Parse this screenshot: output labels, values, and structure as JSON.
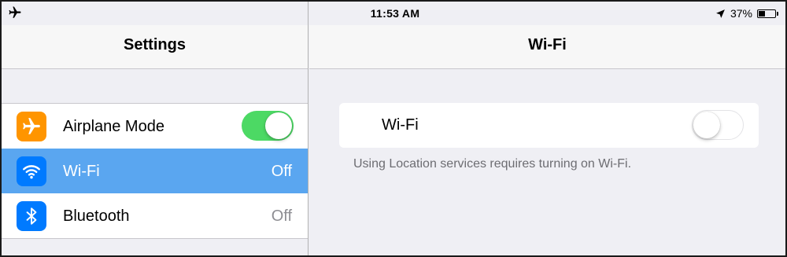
{
  "status_bar": {
    "left_icon": "airplane-icon",
    "time": "11:53 AM",
    "location_icon": "location-arrow-icon",
    "battery_percent": "37%",
    "battery_level": 0.37
  },
  "master": {
    "title": "Settings",
    "items": [
      {
        "label": "Airplane Mode",
        "icon": "airplane-icon",
        "icon_color": "#ff9500",
        "control": "toggle",
        "toggle_on": true
      },
      {
        "label": "Wi-Fi",
        "icon": "wifi-icon",
        "icon_color": "#007aff",
        "value": "Off",
        "selected": true
      },
      {
        "label": "Bluetooth",
        "icon": "bluetooth-icon",
        "icon_color": "#007aff",
        "value": "Off"
      }
    ]
  },
  "detail": {
    "title": "Wi-Fi",
    "wifi_row": {
      "label": "Wi-Fi",
      "toggle_on": false
    },
    "footnote": "Using Location services requires turning on Wi-Fi."
  },
  "colors": {
    "selected_row": "#5aa6f0",
    "toggle_on": "#4cd964",
    "orange": "#ff9500",
    "blue": "#007aff"
  }
}
